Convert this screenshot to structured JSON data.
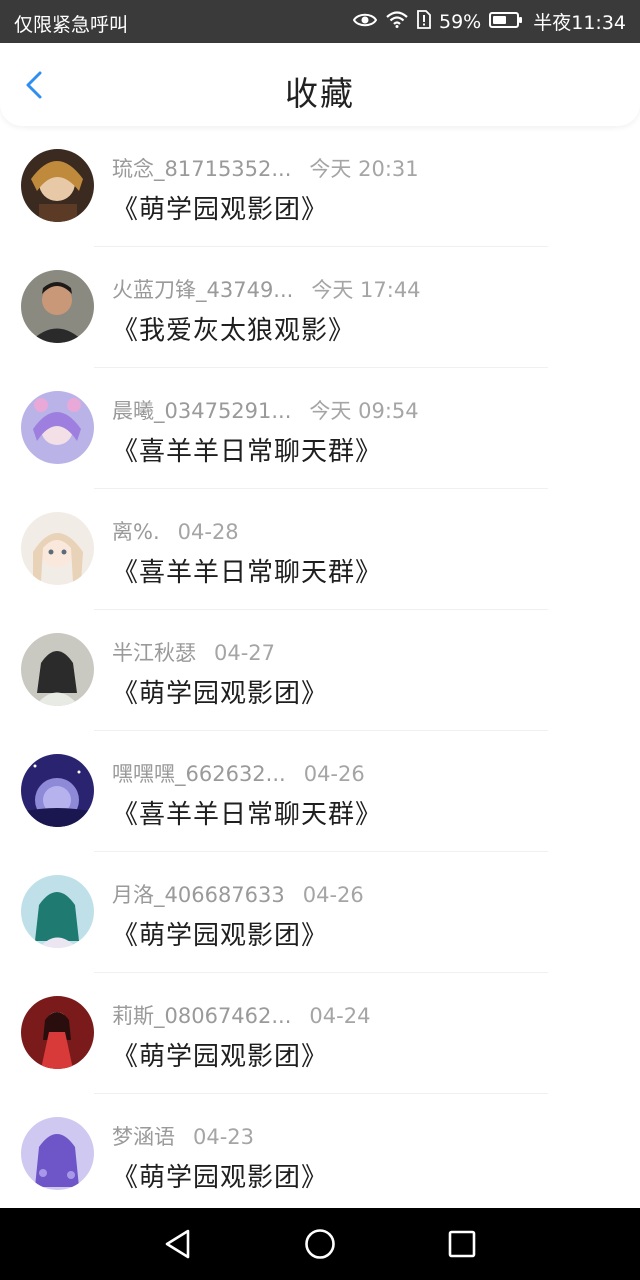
{
  "status_bar": {
    "left_text": "仅限紧急呼叫",
    "battery": "59%",
    "battery_level": 0.59,
    "time": "半夜11:34",
    "icons": [
      "eye-icon",
      "wifi-icon",
      "sim-alert-icon",
      "battery-icon"
    ]
  },
  "header": {
    "title": "收藏",
    "back_icon": "chevron-left-icon"
  },
  "accent_color": "#2f8ff0",
  "items": [
    {
      "name": "琉念_81715352...",
      "time": "今天 20:31",
      "group": "《萌学园观影团》"
    },
    {
      "name": "火蓝刀锋_43749...",
      "time": "今天 17:44",
      "group": "《我爱灰太狼观影》"
    },
    {
      "name": "晨曦_03475291...",
      "time": "今天 09:54",
      "group": "《喜羊羊日常聊天群》"
    },
    {
      "name": "离%.",
      "time": "04-28",
      "group": "《喜羊羊日常聊天群》"
    },
    {
      "name": "半江秋瑟",
      "time": "04-27",
      "group": "《萌学园观影团》"
    },
    {
      "name": "嘿嘿嘿_662632...",
      "time": "04-26",
      "group": "《喜羊羊日常聊天群》"
    },
    {
      "name": "月洛_406687633",
      "time": "04-26",
      "group": "《萌学园观影团》"
    },
    {
      "name": "莉斯_08067462...",
      "time": "04-24",
      "group": "《萌学园观影团》"
    },
    {
      "name": "梦涵语",
      "time": "04-23",
      "group": "《萌学园观影团》"
    }
  ],
  "nav_bar": {
    "icons": [
      "back-triangle-icon",
      "home-circle-icon",
      "recents-square-icon"
    ]
  }
}
